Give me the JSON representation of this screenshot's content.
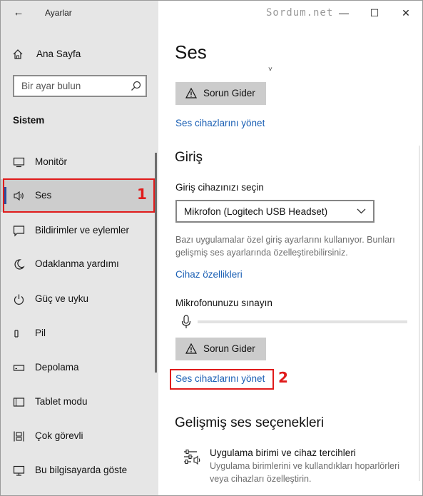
{
  "window": {
    "app_title": "Ayarlar",
    "watermark": "Sordum.net",
    "controls": {
      "minimize": "—",
      "maximize": "☐",
      "close": "✕"
    }
  },
  "sidebar": {
    "home_label": "Ana Sayfa",
    "search_placeholder": "Bir ayar bulun",
    "section_title": "Sistem",
    "items": [
      {
        "label": "Monitör",
        "icon": "monitor-icon"
      },
      {
        "label": "Ses",
        "icon": "speaker-icon",
        "selected": true
      },
      {
        "label": "Bildirimler ve eylemler",
        "icon": "notification-icon"
      },
      {
        "label": "Odaklanma yardımı",
        "icon": "moon-icon"
      },
      {
        "label": "Güç ve uyku",
        "icon": "power-icon"
      },
      {
        "label": "Pil",
        "icon": "battery-icon"
      },
      {
        "label": "Depolama",
        "icon": "storage-icon"
      },
      {
        "label": "Tablet modu",
        "icon": "tablet-icon"
      },
      {
        "label": "Çok görevli",
        "icon": "multitask-icon"
      },
      {
        "label": "Bu bilgisayarda göste",
        "icon": "project-icon"
      }
    ]
  },
  "main": {
    "page_title": "Ses",
    "output": {
      "troubleshoot_label": "Sorun Gider",
      "manage_devices_link": "Ses cihazlarını yönet"
    },
    "input": {
      "heading": "Giriş",
      "choose_label": "Giriş cihazınızı seçin",
      "selected_device": "Mikrofon (Logitech USB Headset)",
      "help_text": "Bazı uygulamalar özel giriş ayarlarını kullanıyor. Bunları gelişmiş ses ayarlarında özelleştirebilirsiniz.",
      "device_properties_link": "Cihaz özellikleri",
      "test_label": "Mikrofonunuzu sınayın",
      "mic_level": 0,
      "troubleshoot_label": "Sorun Gider",
      "manage_devices_link": "Ses cihazlarını yönet"
    },
    "advanced": {
      "heading": "Gelişmiş ses seçenekleri",
      "option_title": "Uygulama birimi ve cihaz tercihleri",
      "option_desc": "Uygulama birimlerini ve kullandıkları hoparlörleri veya cihazları özelleştirin."
    }
  },
  "annotations": {
    "marker_1": "1",
    "marker_2": "2",
    "color": "#e01b1b"
  },
  "colors": {
    "accent": "#2a4d9e",
    "link": "#1a5fb4",
    "sidebar_bg": "#e6e6e6",
    "button_bg": "#cccccc"
  }
}
